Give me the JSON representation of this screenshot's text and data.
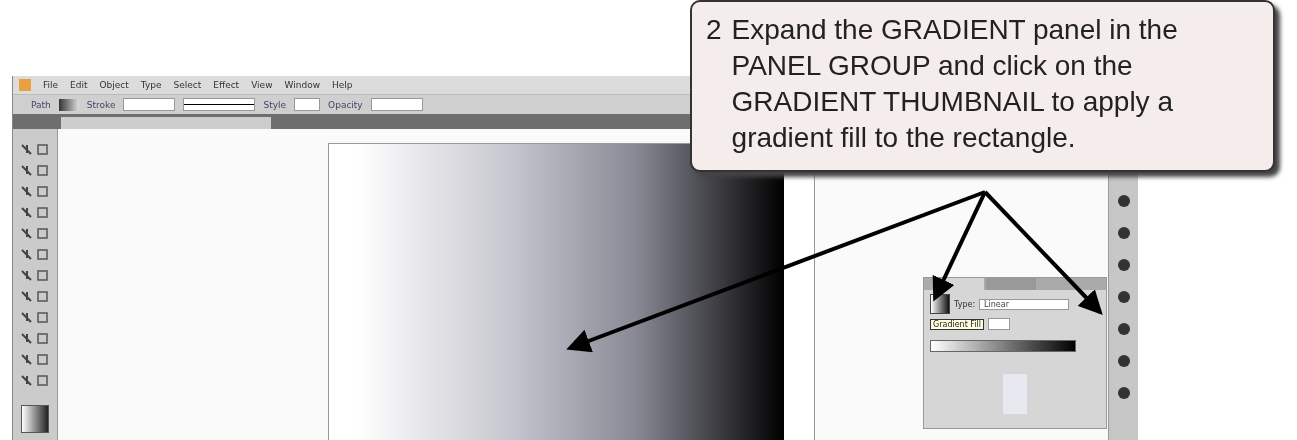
{
  "callout": {
    "step": "2",
    "text": "Expand the GRADIENT panel in the PANEL GROUP and click on the GRADIENT THUMBNAIL to apply a gradient fill to the rectangle."
  },
  "menu_bar": {
    "items": [
      "File",
      "Edit",
      "Object",
      "Type",
      "Select",
      "Effect",
      "View",
      "Window",
      "Help"
    ]
  },
  "control_bar": {
    "selection": "Path",
    "stroke_label": "Stroke",
    "style_label": "Style",
    "opacity_label": "Opacity"
  },
  "gradient_panel": {
    "type_label": "Type:",
    "type_value": "Linear",
    "tooltip": "Gradient Fill"
  }
}
